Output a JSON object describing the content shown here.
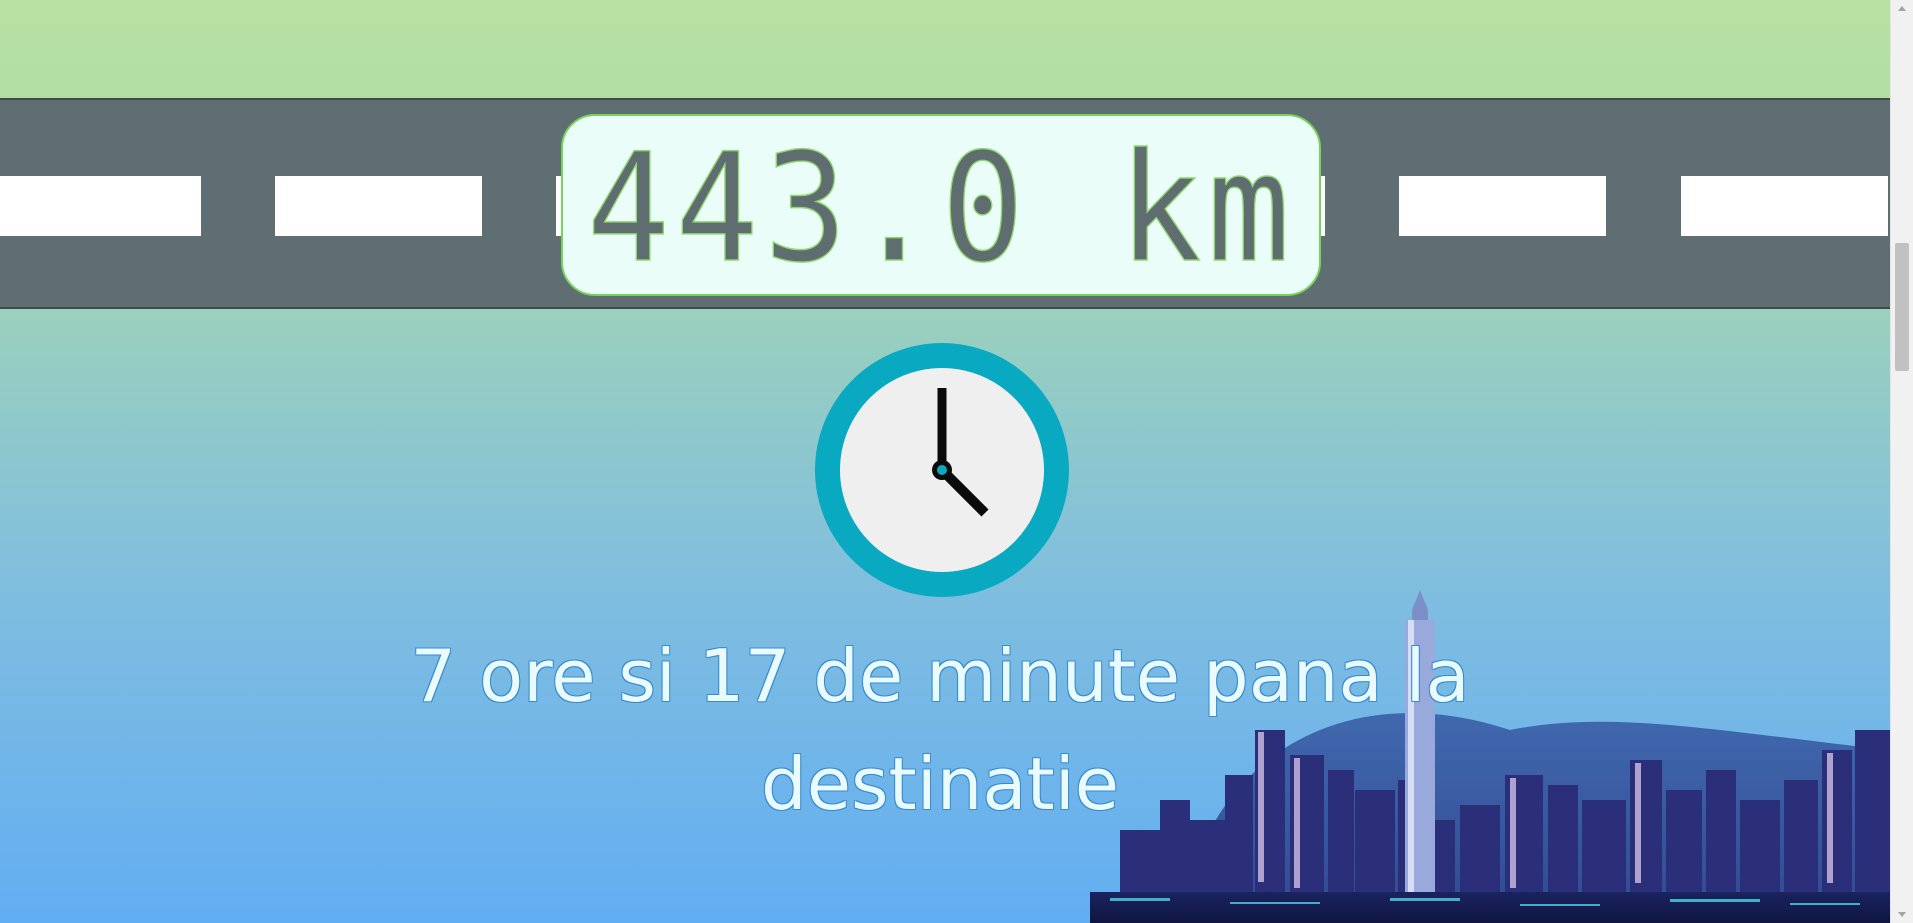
{
  "distance": {
    "value": "443.0 km"
  },
  "clock": {
    "icon": "clock-icon",
    "time_shown": "4:00"
  },
  "eta": {
    "text": "7 ore si 17 de minute pana la destinatie"
  },
  "skyline": {
    "icon": "city-skyline-illustration"
  },
  "colors": {
    "road": "#5e6e73",
    "lane_marking": "#ffffff",
    "distance_box_bg": "#eafdf8",
    "distance_box_border": "#79d35a",
    "distance_text": "#5f6c70",
    "clock_ring": "#0aa9c2",
    "clock_face": "#efefef",
    "eta_text": "#e9fbff"
  },
  "scrollbar": {
    "position_fraction": 0.27
  }
}
